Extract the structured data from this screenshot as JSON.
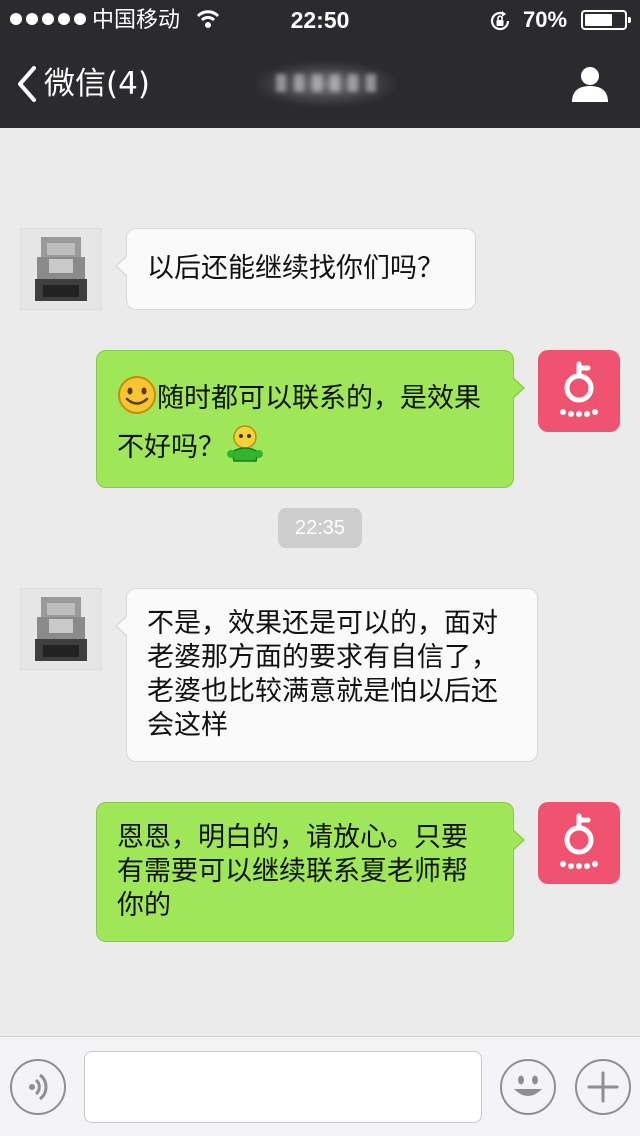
{
  "status_bar": {
    "carrier": "中国移动",
    "time": "22:50",
    "battery_text": "70%",
    "battery_level": 0.7,
    "icons": [
      "signal-dots-icon",
      "wifi-icon",
      "rotation-lock-icon",
      "battery-icon"
    ]
  },
  "nav": {
    "back_label": "微信(4)",
    "icons": [
      "chevron-left-icon",
      "profile-icon"
    ]
  },
  "colors": {
    "bar_bg": "#2b2b2f",
    "chat_bg": "#ebebeb",
    "incoming_bubble": "#fafafa",
    "outgoing_bubble": "#9fe658",
    "agent_avatar": "#f0536f"
  },
  "messages": [
    {
      "direction": "incoming",
      "text": "以后还能继续找你们吗？"
    },
    {
      "direction": "outgoing",
      "emoji_before": "smile-emoji-icon",
      "text": "随时都可以联系的，是效果不好吗？",
      "emoji_after": "green-figure-emoji-icon"
    },
    {
      "direction": "incoming",
      "text": "不是，效果还是可以的，面对老婆那方面的要求有自信了，老婆也比较满意就是怕以后还会这样"
    },
    {
      "direction": "outgoing",
      "text": "恩恩，明白的，请放心。只要有需要可以继续联系夏老师帮你的"
    }
  ],
  "timestamp": "22:35",
  "input_bar": {
    "value": "",
    "icons": [
      "voice-icon",
      "emoji-face-icon",
      "plus-icon"
    ]
  }
}
